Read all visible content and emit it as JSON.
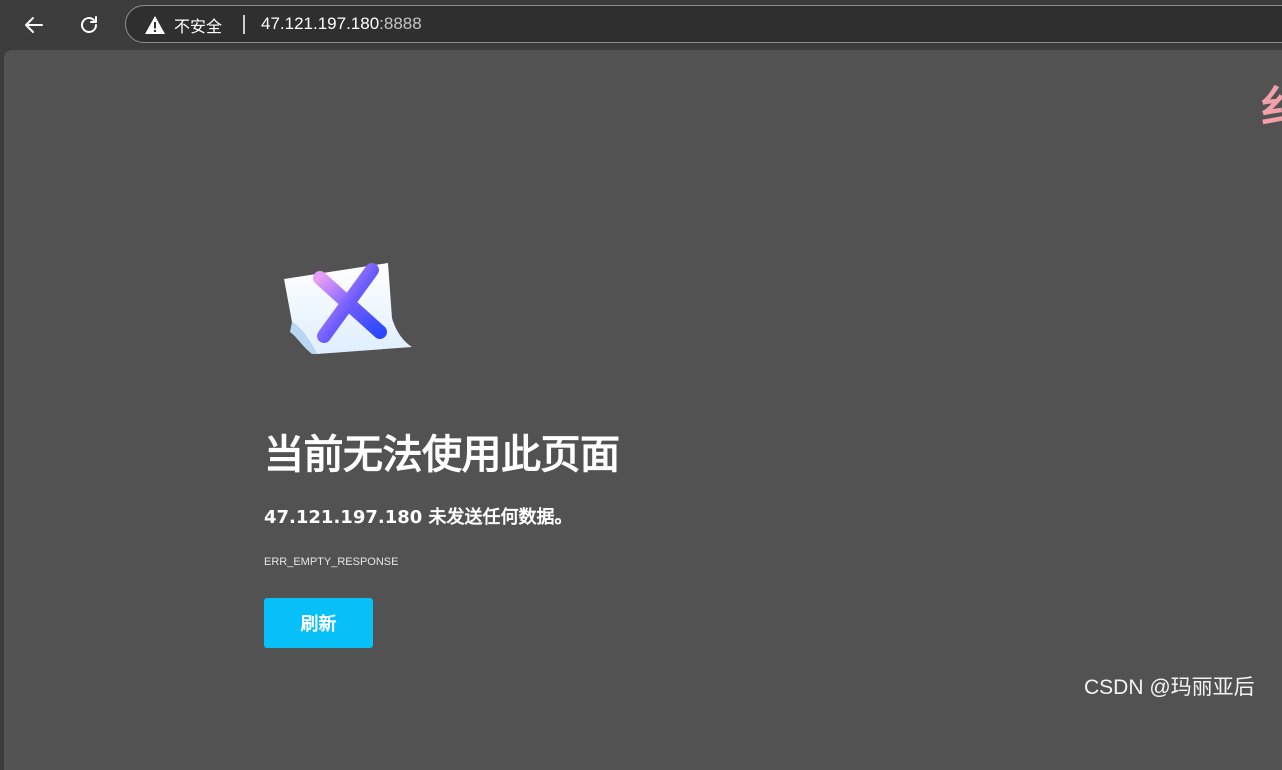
{
  "browser": {
    "security_label": "不安全",
    "url_host": "47.121.197.180",
    "url_port": ":8888",
    "back_icon": "arrow-left-icon",
    "reload_icon": "reload-icon",
    "warning_icon": "warning-triangle-icon"
  },
  "page": {
    "corner_text": "纟",
    "headline": "当前无法使用此页面",
    "subline": "47.121.197.180 未发送任何数据。",
    "error_code": "ERR_EMPTY_RESPONSE",
    "reload_button_label": "刷新",
    "illustration": "error-document-x-icon"
  },
  "watermark": "CSDN @玛丽亚后",
  "colors": {
    "toolbar_bg": "#3c3c3c",
    "page_bg": "#525252",
    "button_bg": "#08c0f8",
    "text": "#ffffff"
  }
}
